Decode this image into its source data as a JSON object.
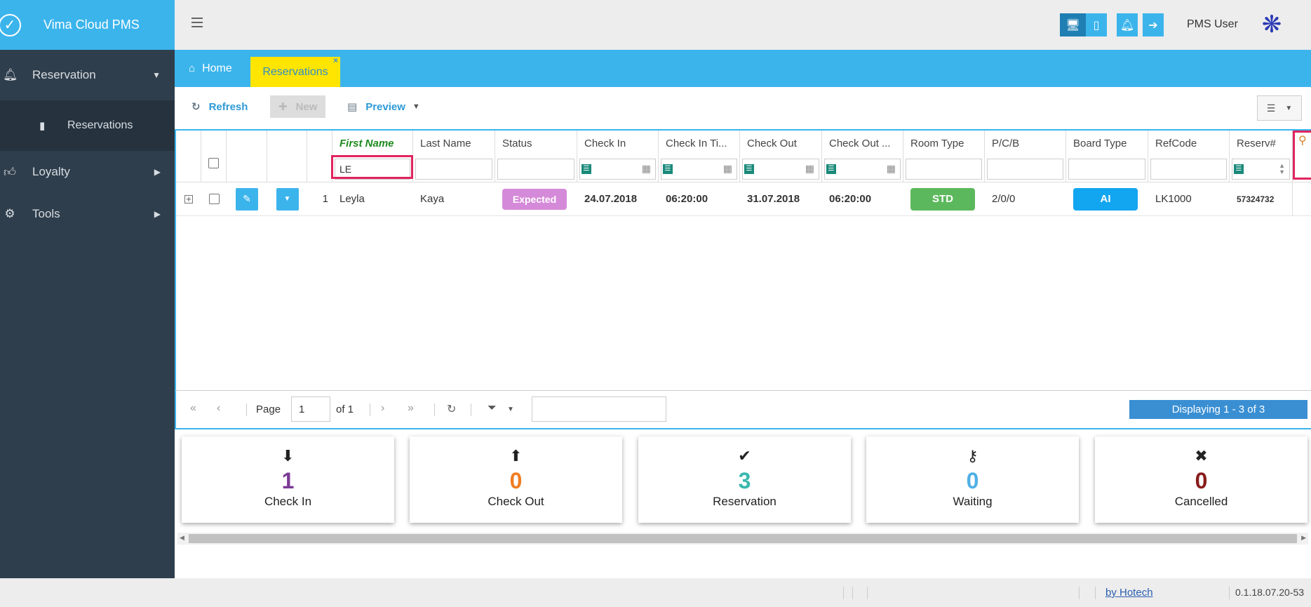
{
  "app": {
    "title": "Vima Cloud PMS"
  },
  "sidebar": {
    "items": [
      {
        "label": "Reservation",
        "icon": "bell-icon"
      },
      {
        "label": "Reservations",
        "icon": "book-icon"
      },
      {
        "label": "Loyalty",
        "icon": "thumbs-up-icon"
      },
      {
        "label": "Tools",
        "icon": "gears-icon"
      }
    ]
  },
  "topbar": {
    "user": "PMS User"
  },
  "tabs": {
    "home": "Home",
    "active": "Reservations",
    "close": "×"
  },
  "toolbar": {
    "refresh": "Refresh",
    "new": "New",
    "preview": "Preview"
  },
  "grid": {
    "columns": [
      "First Name",
      "Last Name",
      "Status",
      "Check In",
      "Check In Ti...",
      "Check Out",
      "Check Out ...",
      "Room Type",
      "P/C/B",
      "Board Type",
      "RefCode",
      "Reserv#"
    ],
    "filter_first_name": "LE",
    "row": {
      "index": "1",
      "first_name": "Leyla",
      "last_name": "Kaya",
      "status": "Expected",
      "check_in": "24.07.2018",
      "check_in_time": "06:20:00",
      "check_out": "31.07.2018",
      "check_out_time": "06:20:00",
      "room_type": "STD",
      "pcb": "2/0/0",
      "board_type": "AI",
      "ref_code": "LK1000",
      "reserv_no": "57324732"
    }
  },
  "pager": {
    "page_label": "Page",
    "page_value": "1",
    "of_label": "of 1",
    "display": "Displaying 1 - 3 of 3"
  },
  "stats": [
    {
      "value": "1",
      "label": "Check In",
      "color": "#7b3a96",
      "icon": "arrow-down-circle-icon"
    },
    {
      "value": "0",
      "label": "Check Out",
      "color": "#f07d22",
      "icon": "arrow-up-circle-icon"
    },
    {
      "value": "3",
      "label": "Reservation",
      "color": "#3ab8ad",
      "icon": "check-icon"
    },
    {
      "value": "0",
      "label": "Waiting",
      "color": "#4fb0e6",
      "icon": "key-icon"
    },
    {
      "value": "0",
      "label": "Cancelled",
      "color": "#8a1c1c",
      "icon": "times-circle-icon"
    }
  ],
  "footer": {
    "link": "by Hotech",
    "version": "0.1.18.07.20-53"
  },
  "colors": {
    "primary": "#3bb4ec",
    "sidebar": "#2f3e4c",
    "tab_active": "#ffe500",
    "status_expected": "#d58ad9",
    "room_std": "#5cb85c",
    "board_ai": "#12a5f0"
  }
}
